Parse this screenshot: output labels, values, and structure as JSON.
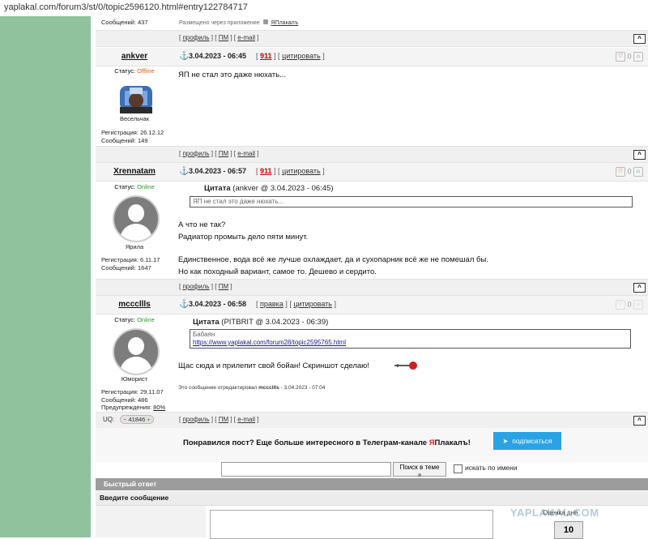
{
  "browser": {
    "url": "yaplakal.com/forum3/st/0/topic2596120.html#entry122784717"
  },
  "prev_post_tail": {
    "messages_label": "Сообщений: 437",
    "app_note": "Размещено через приложение",
    "app_name": "ЯПлакалъ"
  },
  "post_links": {
    "profile": "профиль",
    "pm": "ПМ",
    "email": "e-mail",
    "up": "^"
  },
  "posts": [
    {
      "username": "ankver",
      "date": "3.04.2023 - 06:45",
      "num": "911",
      "action": "цитировать",
      "status_label": "Статус:",
      "status": "Offline",
      "rank": "Весельчак",
      "reg": "Регистрация: 26.12.12",
      "msgs": "Сообщений: 149",
      "vote_count": "0",
      "text": "ЯП не стал это даже нюхать..."
    },
    {
      "username": "Xrennatam",
      "date": "3.04.2023 - 06:57",
      "num": "911",
      "action": "цитировать",
      "status_label": "Статус:",
      "status": "Online",
      "rank": "Ярила",
      "reg": "Регистрация: 6.11.17",
      "msgs": "Сообщений: 1647",
      "vote_count": "0",
      "quote_label": "Цитата",
      "quote_src": "(ankver @ 3.04.2023 - 06:45)",
      "quote_text": "ЯП не стал это даже нюхать...",
      "line1": "А что не так?",
      "line2": "Радиатор промыть дело пяти минут.",
      "line3": "Единственное, вода всё же лучше охлаждает, да и сухопарник всё же не помешал бы.",
      "line4": "Но как походный вариант, самое то. Дешево и сердито."
    },
    {
      "username": "mcccllls",
      "date": "3.04.2023 - 06:58",
      "edit": "правка",
      "action": "цитировать",
      "status_label": "Статус:",
      "status": "Online",
      "rank": "Юморист",
      "reg": "Регистрация: 29.11.07",
      "msgs": "Сообщений: 486",
      "warn_label": "Предупреждения:",
      "warn_value": "80%",
      "uq_label": "UQ:",
      "uq_value": "41846",
      "vote_count": "0",
      "quote_label": "Цитата",
      "quote_src": "(PITBRIT @ 3.04.2023 - 06:39)",
      "quote_text": "Бабаян",
      "quote_link": "https://www.yaplakal.com/forum28/topic2595765.html",
      "text": "Щас сюда и прилепит свой бойан! Скриншот сделаю!",
      "edited_prefix": "Это сообщение отредактировал",
      "edited_user": "mcccllls",
      "edited_suffix": "- 3.04.2023 - 07:04"
    }
  ],
  "telegram": {
    "text_before": "Понравился пост? Еще больше интересного в Телеграм-канале",
    "brand_red": "Я",
    "brand_rest": "Плакалъ!",
    "button": "подписаться"
  },
  "search": {
    "button": "Поиск в теме »",
    "checkbox_label": "искать по имени"
  },
  "quick_reply": {
    "title": "Быстрый ответ",
    "enter_label": "Введите сообщение"
  },
  "watermark": "YAPLAKAL.COM",
  "rating": {
    "label": "Оценка дня",
    "value": "10"
  },
  "colors": {
    "accent_green": "#8fc29d",
    "brand_red": "#e02020",
    "telegram_blue": "#2aa3e6"
  }
}
